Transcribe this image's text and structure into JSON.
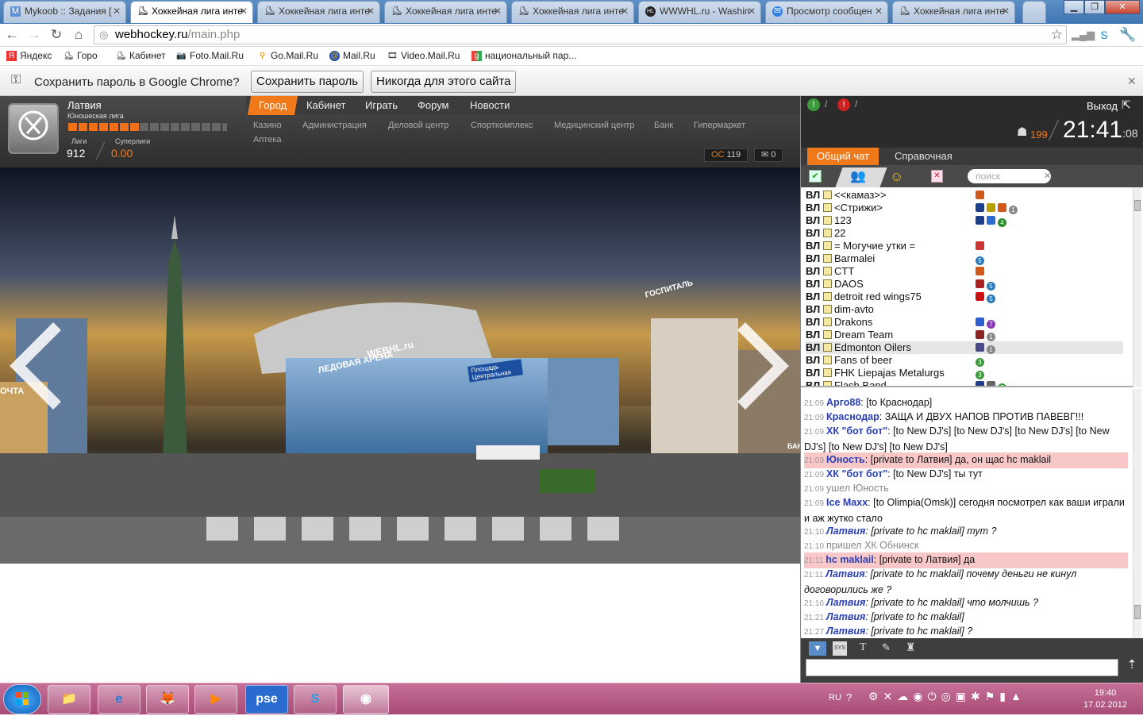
{
  "browser": {
    "tabs": [
      {
        "title": "Mykoob :: Задания [",
        "icon": "mykoob-icon",
        "active": false
      },
      {
        "title": "Хоккейная лига инте",
        "icon": "hockey-player-icon",
        "active": true
      },
      {
        "title": "Хоккейная лига инте",
        "icon": "hockey-player-icon",
        "active": false
      },
      {
        "title": "Хоккейная лига инте",
        "icon": "hockey-player-icon",
        "active": false
      },
      {
        "title": "Хоккейная лига инте",
        "icon": "hockey-player-icon",
        "active": false
      },
      {
        "title": "WWWHL.ru - Washin",
        "icon": "hl-icon",
        "active": false
      },
      {
        "title": "Просмотр сообщен",
        "icon": "mail-icon",
        "active": false
      },
      {
        "title": "Хоккейная лига инте",
        "icon": "hockey-player-icon",
        "active": false
      }
    ],
    "url_domain": "webhockey.ru",
    "url_path": "/main.php",
    "bookmarks": [
      {
        "label": "Яндекс",
        "icon": "yandex-icon"
      },
      {
        "label": "Горо",
        "icon": "hockey-player-icon"
      },
      {
        "label": "Кабинет",
        "icon": "hockey-player-icon"
      },
      {
        "label": "Foto.Mail.Ru",
        "icon": "camera-icon"
      },
      {
        "label": "Go.Mail.Ru",
        "icon": "search-icon"
      },
      {
        "label": "Mail.Ru",
        "icon": "mailru-icon"
      },
      {
        "label": "Video.Mail.Ru",
        "icon": "video-icon"
      },
      {
        "label": "национальный пар...",
        "icon": "google-icon"
      }
    ],
    "infobar": {
      "message": "Сохранить пароль в Google Chrome?",
      "save_label": "Сохранить пароль",
      "never_label": "Никогда для этого сайта"
    }
  },
  "game": {
    "team_name": "Латвия",
    "league_name": "Юношеская лига",
    "rank_progress": 0.45,
    "stats": {
      "leagues_label": "Лиги",
      "leagues_value": "912",
      "superleagues_label": "Суперлиги",
      "superleagues_value": "0.00"
    },
    "nav": [
      "Город",
      "Кабинет",
      "Играть",
      "Форум",
      "Новости"
    ],
    "subnav": [
      "Казино",
      "Администрация",
      "Деловой центр",
      "Спорткомплекс",
      "Медицинский центр",
      "Банк",
      "Гипермаркет",
      "Аптека"
    ],
    "os_label": "ОС",
    "os_value": "119",
    "mail_count": "0",
    "scene": {
      "arena_sign": "WEBHL.ru",
      "arena_name": "ЛЕДОВАЯ АРЕНА",
      "hospital_sign": "ГОСПИТАЛЬ",
      "street_sign_1": "Площадь",
      "street_sign_2": "Центральная",
      "left_sign": "ОЧТА",
      "right_sign": "БАН"
    }
  },
  "chat": {
    "exit_label": "Выход",
    "online_count": "199",
    "clock_hm": "21:41",
    "clock_s": ":08",
    "tabs": [
      "Общий чат",
      "Справочная"
    ],
    "search_placeholder": "поиск",
    "users": [
      {
        "prefix": "ВЛ",
        "name": "<<камаз>>",
        "badges": [
          "hockey"
        ]
      },
      {
        "prefix": "ВЛ",
        "name": "<Стрижи>",
        "badges": [
          "shield",
          "shield2",
          "hockey",
          "1"
        ]
      },
      {
        "prefix": "ВЛ",
        "name": "123",
        "badges": [
          "shield",
          "ukraine",
          "4"
        ]
      },
      {
        "prefix": "ВЛ",
        "name": "22",
        "badges": []
      },
      {
        "prefix": "ВЛ",
        "name": "= Могучие утки =",
        "badges": [
          "russia-flag"
        ]
      },
      {
        "prefix": "ВЛ",
        "name": "Barmalei",
        "badges": [
          "5"
        ]
      },
      {
        "prefix": "ВЛ",
        "name": "CTT",
        "badges": [
          "hockey"
        ]
      },
      {
        "prefix": "ВЛ",
        "name": "DAOS",
        "badges": [
          "gift",
          "5"
        ]
      },
      {
        "prefix": "ВЛ",
        "name": "detroit red wings75",
        "badges": [
          "ussr",
          "5"
        ]
      },
      {
        "prefix": "ВЛ",
        "name": "dim-avto",
        "badges": []
      },
      {
        "prefix": "ВЛ",
        "name": "Drakons",
        "badges": [
          "russia",
          "7"
        ]
      },
      {
        "prefix": "ВЛ",
        "name": "Dream Team",
        "badges": [
          "team",
          "1"
        ]
      },
      {
        "prefix": "ВЛ",
        "name": "Edmonton Oilers",
        "badges": [
          "team2",
          "1"
        ]
      },
      {
        "prefix": "ВЛ",
        "name": "Fans of beer",
        "badges": [
          "3"
        ]
      },
      {
        "prefix": "ВЛ",
        "name": "FHK Liepajas Metalurgs",
        "badges": [
          "3"
        ]
      },
      {
        "prefix": "ВЛ",
        "name": "Flash Band",
        "badges": [
          "shield",
          "film",
          "3"
        ]
      }
    ],
    "messages": [
      {
        "time": "21:09",
        "name": "Арго88",
        "text": ": [to Краснодар]",
        "private": false,
        "italic": false,
        "system": false
      },
      {
        "time": "21:09",
        "name": "Краснодар",
        "text": ": ЗАЩА И ДВУХ НАПОВ ПРОТИВ ПАВЕВГ!!!",
        "private": false,
        "italic": false,
        "system": false
      },
      {
        "time": "21:09",
        "name": "ХК \"бот бот\"",
        "text": ": [to New DJ's] [to New DJ's] [to New DJ's] [to New DJ's] [to New DJ's] [to New DJ's]",
        "private": false,
        "italic": false,
        "system": false
      },
      {
        "time": "21:09",
        "name": "Юность",
        "text": ": [private to Латвия] да, он щас hc maklail",
        "private": true,
        "italic": false,
        "system": false
      },
      {
        "time": "21:09",
        "name": "ХК \"бот бот\"",
        "text": ": [to New DJ's] ты тут",
        "private": false,
        "italic": false,
        "system": false
      },
      {
        "time": "21:09",
        "name": "ушел Юность",
        "text": "",
        "private": false,
        "italic": false,
        "system": true
      },
      {
        "time": "21:09",
        "name": "Ice Maxx",
        "text": ": [to Olimpia(Omsk)] сегодня посмотрел как ваши играли и аж жутко стало",
        "private": false,
        "italic": false,
        "system": false
      },
      {
        "time": "21:10",
        "name": "Латвия",
        "text": ": [private to hc maklail] тут ?",
        "private": false,
        "italic": true,
        "system": false
      },
      {
        "time": "21:10",
        "name": "пришел ХК Обнинск",
        "text": "",
        "private": false,
        "italic": false,
        "system": true
      },
      {
        "time": "21:11",
        "name": "hc maklail",
        "text": ": [private to Латвия] да",
        "private": true,
        "italic": false,
        "system": false
      },
      {
        "time": "21:11",
        "name": "Латвия",
        "text": ": [private to hc maklail] почему деньги не кинул договорились же ?",
        "private": false,
        "italic": true,
        "system": false
      },
      {
        "time": "21:16",
        "name": "Латвия",
        "text": ": [private to hc maklail] что молчишь ?",
        "private": false,
        "italic": true,
        "system": false
      },
      {
        "time": "21:21",
        "name": "Латвия",
        "text": ": [private to hc maklail]",
        "private": false,
        "italic": true,
        "system": false
      },
      {
        "time": "21:27",
        "name": "Латвия",
        "text": ": [private to hc maklail] ?",
        "private": false,
        "italic": true,
        "system": false
      }
    ]
  },
  "taskbar": {
    "apps": [
      "file-explorer-icon",
      "internet-explorer-icon",
      "firefox-icon",
      "media-player-icon",
      "pse-icon",
      "skype-icon",
      "chrome-icon"
    ],
    "pse_label": "pse",
    "lang": "RU",
    "time": "19:40",
    "date": "17.02.2012"
  },
  "colors": {
    "accent": "#f07a1a",
    "chat_name": "#2a3fb6",
    "private_bg": "#f8c8c8",
    "taskbar": "#b65a86"
  }
}
